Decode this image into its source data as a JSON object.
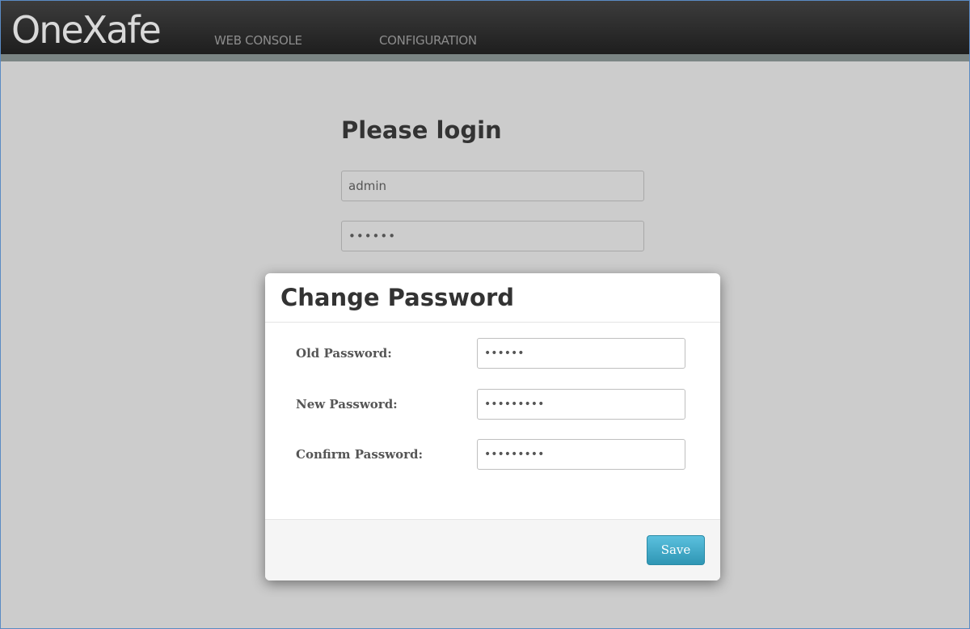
{
  "header": {
    "brand": "OneXafe",
    "nav": [
      {
        "label": "WEB CONSOLE"
      },
      {
        "label": "CONFIGURATION"
      }
    ]
  },
  "login": {
    "title": "Please login",
    "username_value": "admin",
    "password_value": "••••••"
  },
  "dialog": {
    "title": "Change Password",
    "fields": [
      {
        "label": "Old Password:",
        "value": "••••••"
      },
      {
        "label": "New Password:",
        "value": "•••••••••"
      },
      {
        "label": "Confirm Password:",
        "value": "•••••••••"
      }
    ],
    "save_label": "Save"
  },
  "colors": {
    "accent": "#49afcd",
    "navbar": "#2b2b2b",
    "background": "#cccccc"
  }
}
